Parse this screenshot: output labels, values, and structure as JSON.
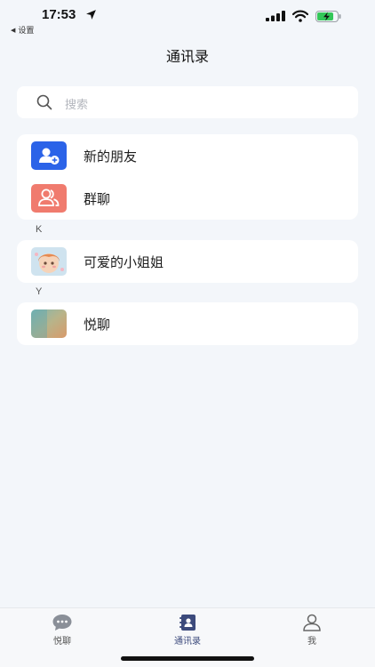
{
  "status_bar": {
    "time": "17:53",
    "back_label": "设置"
  },
  "header": {
    "title": "通讯录"
  },
  "search": {
    "placeholder": "搜索"
  },
  "top_items": [
    {
      "label": "新的朋友",
      "icon": "add-friend-icon",
      "color": "#2b63e8"
    },
    {
      "label": "群聊",
      "icon": "group-chat-icon",
      "color": "#f07b6e"
    }
  ],
  "sections": [
    {
      "letter": "K",
      "contacts": [
        {
          "name": "可爱的小姐姐"
        }
      ]
    },
    {
      "letter": "Y",
      "contacts": [
        {
          "name": "悦聊"
        }
      ]
    }
  ],
  "tab_bar": {
    "tabs": [
      {
        "label": "悦聊",
        "icon": "chat-bubble-icon"
      },
      {
        "label": "通讯录",
        "icon": "contacts-book-icon",
        "active": true
      },
      {
        "label": "我",
        "icon": "person-icon"
      }
    ]
  },
  "colors": {
    "accent": "#2b63e8",
    "active_tab": "#3c4a7c",
    "background": "#f3f6fa"
  }
}
